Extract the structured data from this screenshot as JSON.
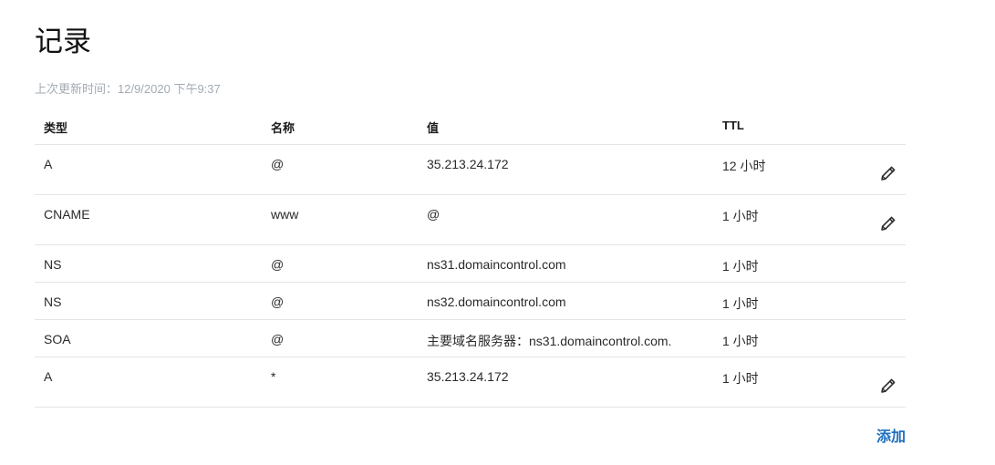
{
  "page": {
    "title": "记录",
    "updated_label": "上次更新时间：12/9/2020 下午9:37"
  },
  "table": {
    "columns": {
      "type": "类型",
      "name": "名称",
      "value": "值",
      "ttl": "TTL"
    },
    "rows": [
      {
        "type": "A",
        "name": "@",
        "value": "35.213.24.172",
        "ttl": "12 小时",
        "editable": true
      },
      {
        "type": "CNAME",
        "name": "www",
        "value": "@",
        "ttl": "1 小时",
        "editable": true
      },
      {
        "type": "NS",
        "name": "@",
        "value": "ns31.domaincontrol.com",
        "ttl": "1 小时",
        "editable": false
      },
      {
        "type": "NS",
        "name": "@",
        "value": "ns32.domaincontrol.com",
        "ttl": "1 小时",
        "editable": false
      },
      {
        "type": "SOA",
        "name": "@",
        "value": "主要域名服务器：ns31.domaincontrol.com.",
        "ttl": "1 小时",
        "editable": false
      },
      {
        "type": "A",
        "name": "*",
        "value": "35.213.24.172",
        "ttl": "1 小时",
        "editable": true
      }
    ]
  },
  "actions": {
    "add_label": "添加",
    "edit_icon": "pencil-icon"
  },
  "colors": {
    "link": "#1f6fbf",
    "muted_text": "#a3abb4",
    "divider": "#e4e4e4"
  }
}
